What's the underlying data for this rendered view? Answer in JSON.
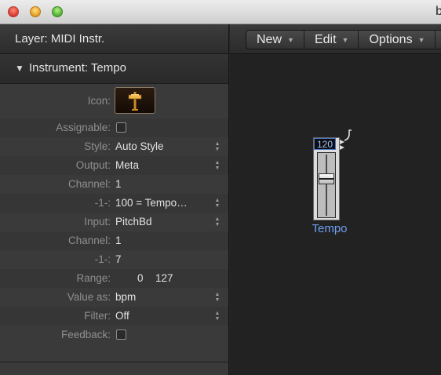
{
  "window": {
    "title": "b"
  },
  "inspector": {
    "layer_label": "Layer: MIDI Instr.",
    "section_title": "Instrument: Tempo",
    "rows": [
      {
        "label": "Icon:",
        "type": "icon",
        "icon": "fader-icon"
      },
      {
        "label": "Assignable:",
        "type": "checkbox",
        "checked": false
      },
      {
        "label": "Style:",
        "value": "Auto Style",
        "type": "popup"
      },
      {
        "label": "Output:",
        "value": "Meta",
        "type": "popup"
      },
      {
        "label": "Channel:",
        "value": "1",
        "type": "text"
      },
      {
        "label": "-1-:",
        "value": "100 = Tempo…",
        "type": "popup"
      },
      {
        "label": "Input:",
        "value": "PitchBd",
        "type": "popup"
      },
      {
        "label": "Channel:",
        "value": "1",
        "type": "text"
      },
      {
        "label": "-1-:",
        "value": "7",
        "type": "text"
      },
      {
        "label": "Range:",
        "range_low": "0",
        "range_high": "127",
        "type": "range"
      },
      {
        "label": "Value as:",
        "value": "bpm",
        "type": "popup"
      },
      {
        "label": "Filter:",
        "value": "Off",
        "type": "popup"
      },
      {
        "label": "Feedback:",
        "type": "checkbox",
        "checked": false
      }
    ]
  },
  "environment": {
    "menus": [
      {
        "label": "New"
      },
      {
        "label": "Edit"
      },
      {
        "label": "Options"
      }
    ],
    "tempo_object": {
      "readout": "120",
      "name": "Tempo",
      "fader_level": 0.62
    }
  },
  "colors": {
    "accent_blue": "#6e9ff0",
    "panel_bg": "#3a3a3a",
    "canvas_bg": "#222222"
  }
}
